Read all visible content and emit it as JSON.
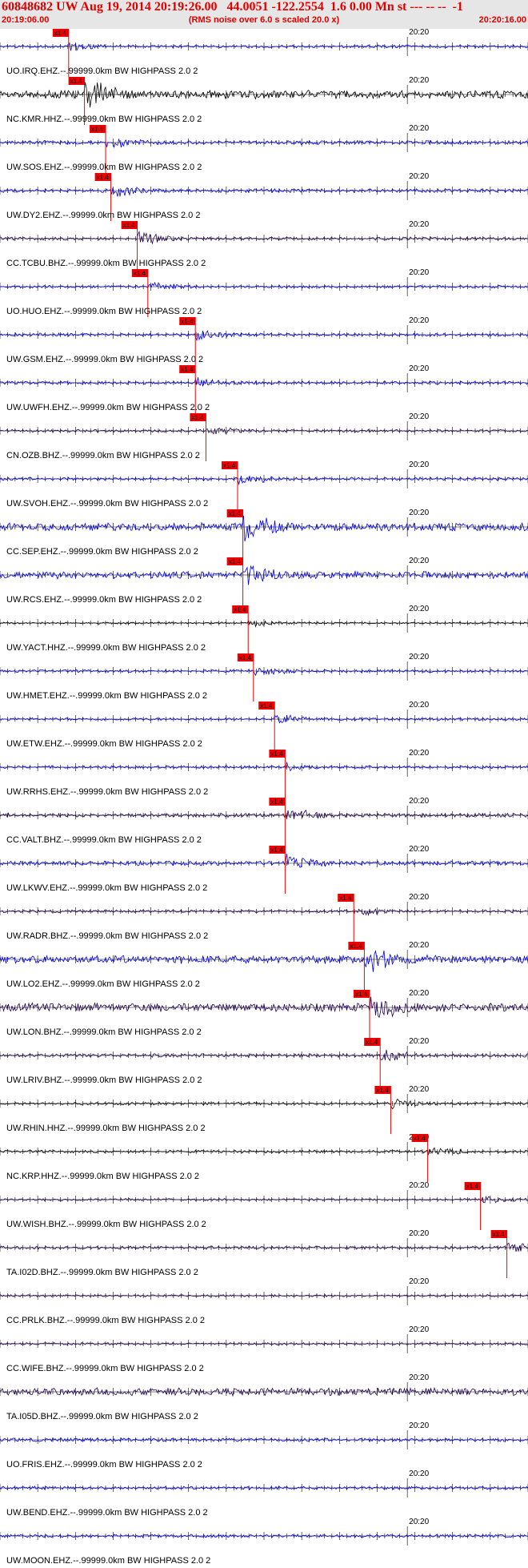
{
  "header": {
    "title": "60848682 UW Aug 19, 2014 20:19:26.00   44.0051 -122.2554  1.6 0.00 Mn st --- -- --  -1",
    "start_time": "20:19:06.00",
    "note": "(RMS noise over 6.0 s scaled 20.0 x)",
    "end_time": "20:20:16.00"
  },
  "chart_data": {
    "type": "line",
    "xlim": [
      "20:19:06.00",
      "20:20:16.00"
    ],
    "minute_mark_label": "20:20",
    "pick_label": "x1.4",
    "colors": {
      "blue": "#0000ee",
      "purple": "#220055",
      "black": "#000000",
      "pick": "#ee0000",
      "label": "#000000"
    },
    "series": [
      {
        "name": "UO.IRQ.EHZ.--.99999.0km BW  HIGHPASS  2.0  2",
        "color": "blue",
        "amp": 0.25,
        "pick": 0.13
      },
      {
        "name": "NC.KMR.HHZ.--.99999.0km BW  HIGHPASS  2.0  2",
        "color": "black",
        "amp": 0.9,
        "pick": 0.16
      },
      {
        "name": "UW.SOS.EHZ.--.99999.0km BW  HIGHPASS  2.0  2",
        "color": "blue",
        "amp": 0.4,
        "pick": 0.2
      },
      {
        "name": "UW.DY2.EHZ.--.99999.0km BW  HIGHPASS  2.0  2",
        "color": "blue",
        "amp": 0.35,
        "pick": 0.21
      },
      {
        "name": "CC.TCBU.BHZ.--.99999.0km BW  HIGHPASS  2.0  2",
        "color": "purple",
        "amp": 0.3,
        "pick": 0.26
      },
      {
        "name": "UO.HUO.EHZ.--.99999.0km BW  HIGHPASS  2.0  2",
        "color": "blue",
        "amp": 0.25,
        "pick": 0.28
      },
      {
        "name": "UW.GSM.EHZ.--.99999.0km BW  HIGHPASS  2.0  2",
        "color": "blue",
        "amp": 0.3,
        "pick": 0.37
      },
      {
        "name": "UW.UWFH.EHZ.--.99999.0km BW  HIGHPASS  2.0  2",
        "color": "blue",
        "amp": 0.3,
        "pick": 0.37
      },
      {
        "name": "CN.OZB.BHZ.--.99999.0km BW  HIGHPASS  2.0  2",
        "color": "purple",
        "amp": 0.25,
        "pick": 0.39
      },
      {
        "name": "UW.SVOH.EHZ.--.99999.0km BW  HIGHPASS  2.0  2",
        "color": "blue",
        "amp": 0.3,
        "pick": 0.45
      },
      {
        "name": "CC.SEP.EHZ.--.99999.0km BW  HIGHPASS  2.0  2",
        "color": "blue",
        "amp": 0.9,
        "pick": 0.46
      },
      {
        "name": "UW.RCS.EHZ.--.99999.0km BW  HIGHPASS  2.0  2",
        "color": "blue",
        "amp": 0.8,
        "pick": 0.46
      },
      {
        "name": "UW.YACT.HHZ.--.99999.0km BW  HIGHPASS  2.0  2",
        "color": "black",
        "amp": 0.15,
        "pick": 0.47
      },
      {
        "name": "UW.HMET.EHZ.--.99999.0km BW  HIGHPASS  2.0  2",
        "color": "blue",
        "amp": 0.25,
        "pick": 0.48
      },
      {
        "name": "UW.ETW.EHZ.--.99999.0km BW  HIGHPASS  2.0  2",
        "color": "blue",
        "amp": 0.25,
        "pick": 0.52
      },
      {
        "name": "UW.RRHS.EHZ.--.99999.0km BW  HIGHPASS  2.0  2",
        "color": "blue",
        "amp": 0.25,
        "pick": 0.54
      },
      {
        "name": "CC.VALT.BHZ.--.99999.0km BW  HIGHPASS  2.0  2",
        "color": "purple",
        "amp": 0.4,
        "pick": 0.54
      },
      {
        "name": "UW.LKWV.EHZ.--.99999.0km BW  HIGHPASS  2.0  2",
        "color": "blue",
        "amp": 0.45,
        "pick": 0.54
      },
      {
        "name": "UW.RADR.BHZ.--.99999.0km BW  HIGHPASS  2.0  2",
        "color": "purple",
        "amp": 0.25,
        "pick": 0.67
      },
      {
        "name": "UW.LO2.EHZ.--.99999.0km BW  HIGHPASS  2.0  2",
        "color": "blue",
        "amp": 0.9,
        "pick": 0.69
      },
      {
        "name": "UW.LON.BHZ.--.99999.0km BW  HIGHPASS  2.0  2",
        "color": "purple",
        "amp": 0.95,
        "pick": 0.7
      },
      {
        "name": "UW.LRIV.BHZ.--.99999.0km BW  HIGHPASS  2.0  2",
        "color": "purple",
        "amp": 0.35,
        "pick": 0.72
      },
      {
        "name": "UW.RHIN.HHZ.--.99999.0km BW  HIGHPASS  2.0  2",
        "color": "black",
        "amp": 0.25,
        "pick": 0.74
      },
      {
        "name": "NC.KRP.HHZ.--.99999.0km BW  HIGHPASS  2.0  2",
        "color": "black",
        "amp": 0.25,
        "pick": 0.81
      },
      {
        "name": "UW.WISH.BHZ.--.99999.0km BW  HIGHPASS  2.0  2",
        "color": "purple",
        "amp": 0.2,
        "pick": 0.91
      },
      {
        "name": "TA.I02D.BHZ.--.99999.0km BW  HIGHPASS  2.0  2",
        "color": "purple",
        "amp": 0.3,
        "pick": 0.96
      },
      {
        "name": "CC.PRLK.BHZ.--.99999.0km BW  HIGHPASS  2.0  2",
        "color": "purple",
        "amp": 0.2,
        "pick": null
      },
      {
        "name": "CC.WIFE.BHZ.--.99999.0km BW  HIGHPASS  2.0  2",
        "color": "purple",
        "amp": 0.2,
        "pick": null
      },
      {
        "name": "TA.I05D.BHZ.--.99999.0km BW  HIGHPASS  2.0  2",
        "color": "purple",
        "amp": 0.85,
        "pick": null
      },
      {
        "name": "UO.FRIS.EHZ.--.99999.0km BW  HIGHPASS  2.0  2",
        "color": "blue",
        "amp": 0.35,
        "pick": null
      },
      {
        "name": "UW.BEND.EHZ.--.99999.0km BW  HIGHPASS  2.0  2",
        "color": "blue",
        "amp": 0.3,
        "pick": null
      },
      {
        "name": "UW.MOON.EHZ.--.99999.0km BW  HIGHPASS  2.0  2",
        "color": "blue",
        "amp": 0.3,
        "pick": null
      }
    ]
  }
}
